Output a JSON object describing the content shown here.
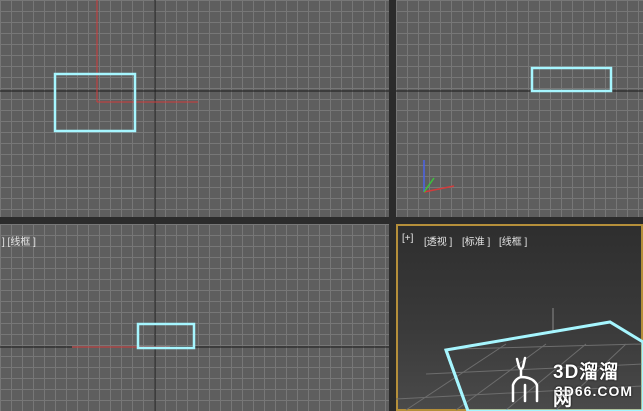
{
  "viewports": {
    "left": {
      "label": "] [线框 ]"
    },
    "perspective": {
      "labels": [
        "[+]",
        "[透视 ]",
        "[标准 ]",
        "[线框 ]"
      ]
    }
  },
  "colors": {
    "selection": "#a6f6ff",
    "axis_x": "#d23b3b",
    "axis_y": "#d23b3b",
    "active_border": "#b58f3a",
    "grid_major": "#1a1a1a"
  },
  "watermark": {
    "line1": "3D溜溜网",
    "line2": "3D66.COM",
    "icon": "deer-icon"
  }
}
